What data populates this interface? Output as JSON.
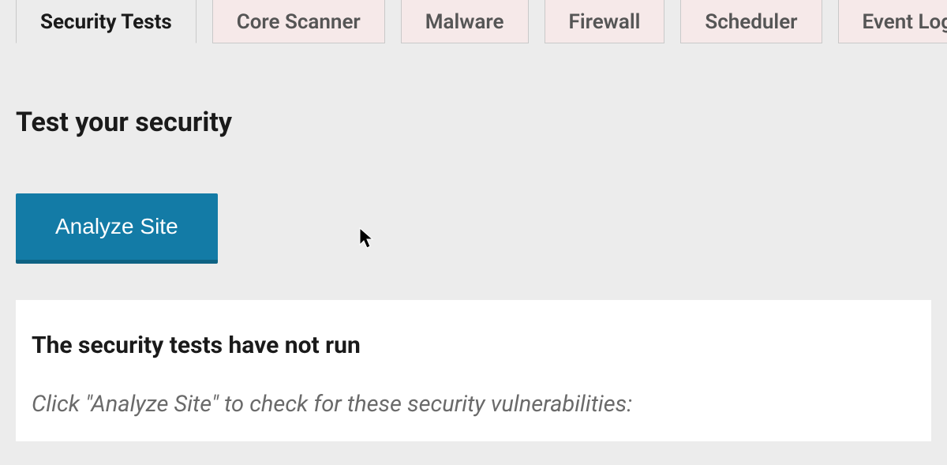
{
  "tabs": {
    "items": [
      {
        "label": "Security Tests",
        "active": true
      },
      {
        "label": "Core Scanner",
        "active": false
      },
      {
        "label": "Malware",
        "active": false
      },
      {
        "label": "Firewall",
        "active": false
      },
      {
        "label": "Scheduler",
        "active": false
      },
      {
        "label": "Event Log",
        "active": false
      }
    ]
  },
  "main": {
    "section_title": "Test your security",
    "analyze_button_label": "Analyze Site"
  },
  "results": {
    "heading": "The security tests have not run",
    "subtext": "Click \"Analyze Site\" to check for these security vulnerabilities:"
  }
}
